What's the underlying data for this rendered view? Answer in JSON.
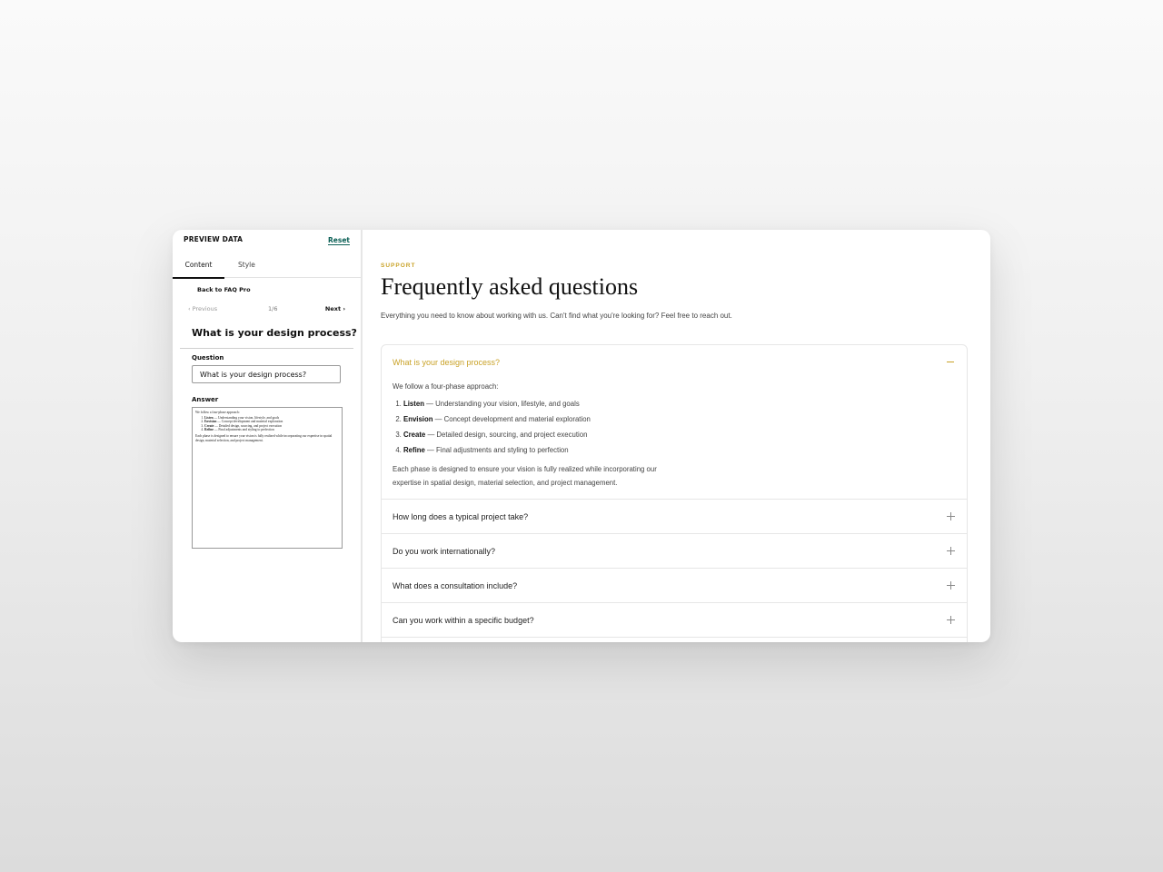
{
  "sidebar": {
    "title": "PREVIEW DATA",
    "reset_label": "Reset",
    "tabs": [
      {
        "label": "Content"
      },
      {
        "label": "Style"
      }
    ],
    "back_label": "Back to FAQ Pro",
    "prev_label": "‹ Previous",
    "next_label": "Next ›",
    "counter": "1/6",
    "current_question": "What is your design process?",
    "question_label": "Question",
    "question_value": "What is your design process?",
    "answer_label": "Answer",
    "answer_preview": {
      "intro": "We follow a four-phase approach:",
      "steps": [
        {
          "term": "Listen",
          "text": " — Understanding your vision, lifestyle, and goals"
        },
        {
          "term": "Envision",
          "text": " — Concept development and material exploration"
        },
        {
          "term": "Create",
          "text": " — Detailed design, sourcing, and project execution"
        },
        {
          "term": "Refine",
          "text": " — Final adjustments and styling to perfection"
        }
      ],
      "outro": "Each phase is designed to ensure your vision is fully realized while incorporating our expertise in spatial design, material selection, and project management."
    }
  },
  "main": {
    "eyebrow": "SUPPORT",
    "title": "Frequently asked questions",
    "subtitle": "Everything you need to know about working with us. Can't find what you're looking for? Feel free to reach out.",
    "accent_color": "#c9a227",
    "open_item": {
      "question": "What is your design process?",
      "intro": "We follow a four-phase approach:",
      "steps": [
        {
          "term": "Listen",
          "text": " — Understanding your vision, lifestyle, and goals"
        },
        {
          "term": "Envision",
          "text": " — Concept development and material exploration"
        },
        {
          "term": "Create",
          "text": " — Detailed design, sourcing, and project execution"
        },
        {
          "term": "Refine",
          "text": " — Final adjustments and styling to perfection"
        }
      ],
      "outro": "Each phase is designed to ensure your vision is fully realized while incorporating our expertise in spatial design, material selection, and project management."
    },
    "items": [
      {
        "question": "How long does a typical project take?"
      },
      {
        "question": "Do you work internationally?"
      },
      {
        "question": "What does a consultation include?"
      },
      {
        "question": "Can you work within a specific budget?"
      }
    ]
  }
}
